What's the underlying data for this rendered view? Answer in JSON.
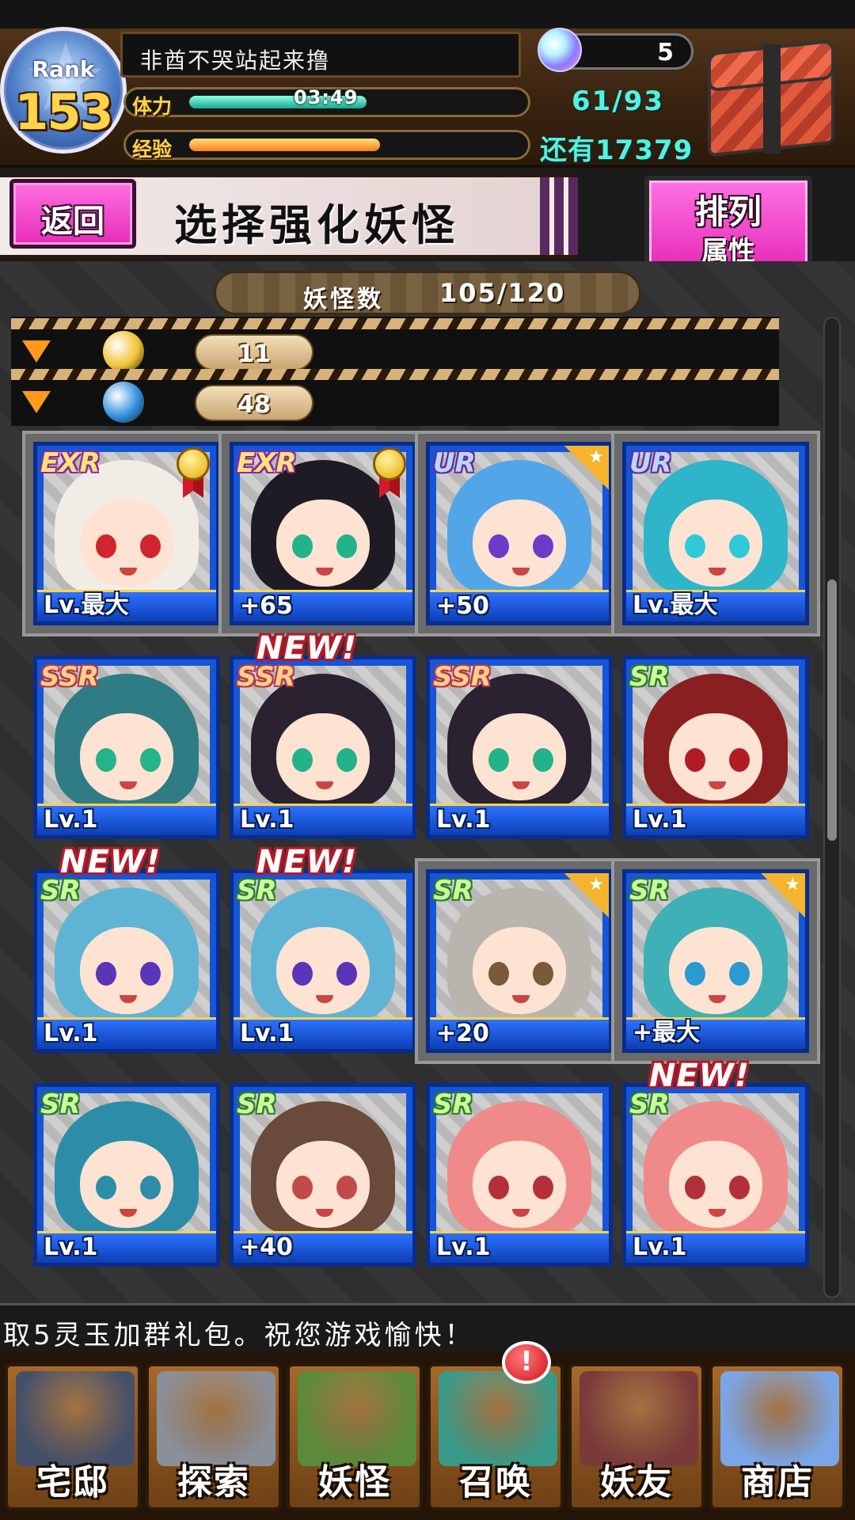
{
  "header": {
    "rank_label": "Rank",
    "rank": "153",
    "player_name": "非酋不哭站起来撸",
    "stamina_label": "体力",
    "stamina_timer": "03:49",
    "stamina_value": "61/93",
    "stamina_fraction": 0.66,
    "exp_label": "经验",
    "exp_remaining": "还有17379",
    "exp_fraction": 0.71,
    "gems": "5"
  },
  "title_bar": {
    "back_label": "返回",
    "title": "选择强化妖怪",
    "sort_label": "排列",
    "sort_sub": "属性"
  },
  "inventory": {
    "count_label": "妖怪数",
    "count_value": "105/120"
  },
  "filters": [
    {
      "icon": "gold-element-icon",
      "value": "11",
      "color": "#f1c232"
    },
    {
      "icon": "water-element-icon",
      "value": "48",
      "color": "#2f8fe0"
    }
  ],
  "yokai": [
    {
      "rarity": "EXR",
      "level": "Lv.最大",
      "badge": "medal",
      "locked": true,
      "hair": "#f1ede6",
      "eyes": "#d0252e",
      "is_new": false
    },
    {
      "rarity": "EXR",
      "level": "+65",
      "badge": "medal",
      "locked": true,
      "hair": "#1f1b24",
      "eyes": "#23b38a",
      "is_new": false
    },
    {
      "rarity": "UR",
      "level": "+50",
      "badge": "star",
      "locked": true,
      "hair": "#52a6e8",
      "eyes": "#6a3ac8",
      "is_new": false
    },
    {
      "rarity": "UR",
      "level": "Lv.最大",
      "badge": "none",
      "locked": true,
      "hair": "#2fb5c9",
      "eyes": "#2fc9d9",
      "is_new": false
    },
    {
      "rarity": "SSR",
      "level": "Lv.1",
      "badge": "none",
      "locked": false,
      "hair": "#2f7c84",
      "eyes": "#25b38a",
      "is_new": false
    },
    {
      "rarity": "SSR",
      "level": "Lv.1",
      "badge": "none",
      "locked": false,
      "hair": "#2a2230",
      "eyes": "#23b38a",
      "is_new": true
    },
    {
      "rarity": "SSR",
      "level": "Lv.1",
      "badge": "none",
      "locked": false,
      "hair": "#2a2230",
      "eyes": "#23b38a",
      "is_new": false
    },
    {
      "rarity": "SR",
      "level": "Lv.1",
      "badge": "none",
      "locked": false,
      "hair": "#8a1f22",
      "eyes": "#b31c25",
      "is_new": false
    },
    {
      "rarity": "SR",
      "level": "Lv.1",
      "badge": "none",
      "locked": false,
      "hair": "#5fb4d6",
      "eyes": "#5a35b8",
      "is_new": true
    },
    {
      "rarity": "SR",
      "level": "Lv.1",
      "badge": "none",
      "locked": false,
      "hair": "#5fb4d6",
      "eyes": "#5a35b8",
      "is_new": true
    },
    {
      "rarity": "SR",
      "level": "+20",
      "badge": "star",
      "locked": true,
      "hair": "#b9b4ae",
      "eyes": "#7a5a3a",
      "is_new": false
    },
    {
      "rarity": "SR",
      "level": "+最大",
      "badge": "star",
      "locked": true,
      "hair": "#3fb0b5",
      "eyes": "#2a9ad0",
      "is_new": false
    },
    {
      "rarity": "SR",
      "level": "Lv.1",
      "badge": "none",
      "locked": false,
      "hair": "#2d8da8",
      "eyes": "#2d8da8",
      "is_new": false
    },
    {
      "rarity": "SR",
      "level": "+40",
      "badge": "none",
      "locked": false,
      "hair": "#6a4a3a",
      "eyes": "#c24a4a",
      "is_new": false
    },
    {
      "rarity": "SR",
      "level": "Lv.1",
      "badge": "none",
      "locked": false,
      "hair": "#f08a8a",
      "eyes": "#b3303a",
      "is_new": false
    },
    {
      "rarity": "SR",
      "level": "Lv.1",
      "badge": "none",
      "locked": false,
      "hair": "#f08a8a",
      "eyes": "#b3303a",
      "is_new": true
    }
  ],
  "new_tag": "NEW!",
  "ticker": "取5灵玉加群礼包。祝您游戏愉快！",
  "nav": [
    {
      "label": "宅邸",
      "icon": "mansion-icon",
      "color": "#44506a"
    },
    {
      "label": "探索",
      "icon": "magnifier-icon",
      "color": "#8a8f9a"
    },
    {
      "label": "妖怪",
      "icon": "scroll-icon",
      "color": "#5a8a3a"
    },
    {
      "label": "召唤",
      "icon": "pentagram-icon",
      "color": "#3a9a8a"
    },
    {
      "label": "妖友",
      "icon": "catgirl-icon",
      "color": "#7a3a3a"
    },
    {
      "label": "商店",
      "icon": "crystal-orb-icon",
      "color": "#7aa6e8"
    }
  ],
  "nav_alert": "!"
}
